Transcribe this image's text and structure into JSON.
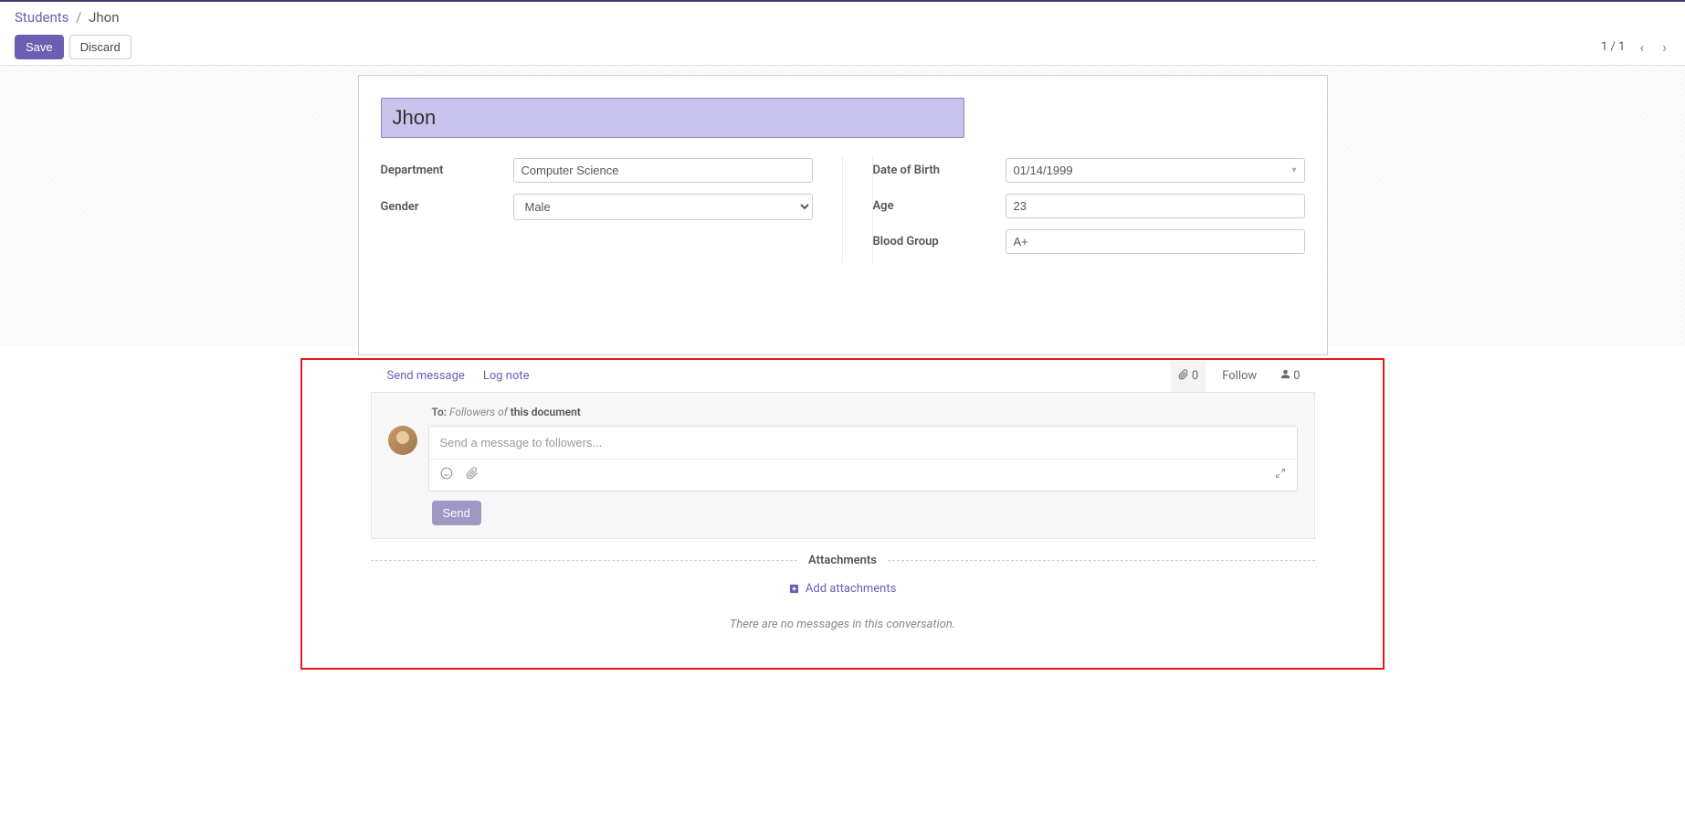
{
  "breadcrumb": {
    "parent": "Students",
    "separator": "/",
    "current": "Jhon"
  },
  "toolbar": {
    "save_label": "Save",
    "discard_label": "Discard",
    "pager": "1 / 1"
  },
  "form": {
    "name": "Jhon",
    "left": {
      "department_label": "Department",
      "department_value": "Computer Science",
      "gender_label": "Gender",
      "gender_value": "Male"
    },
    "right": {
      "dob_label": "Date of Birth",
      "dob_value": "01/14/1999",
      "age_label": "Age",
      "age_value": "23",
      "blood_label": "Blood Group",
      "blood_value": "A+"
    }
  },
  "chatter": {
    "tabs": {
      "send_message": "Send message",
      "log_note": "Log note"
    },
    "attachments_count": "0",
    "follow_label": "Follow",
    "followers_count": "0",
    "to_label": "To:",
    "followers_of": "Followers of ",
    "this_document": "this document",
    "composer_placeholder": "Send a message to followers...",
    "send_label": "Send",
    "attachments_header": "Attachments",
    "add_attachments": "Add attachments",
    "no_messages": "There are no messages in this conversation."
  }
}
